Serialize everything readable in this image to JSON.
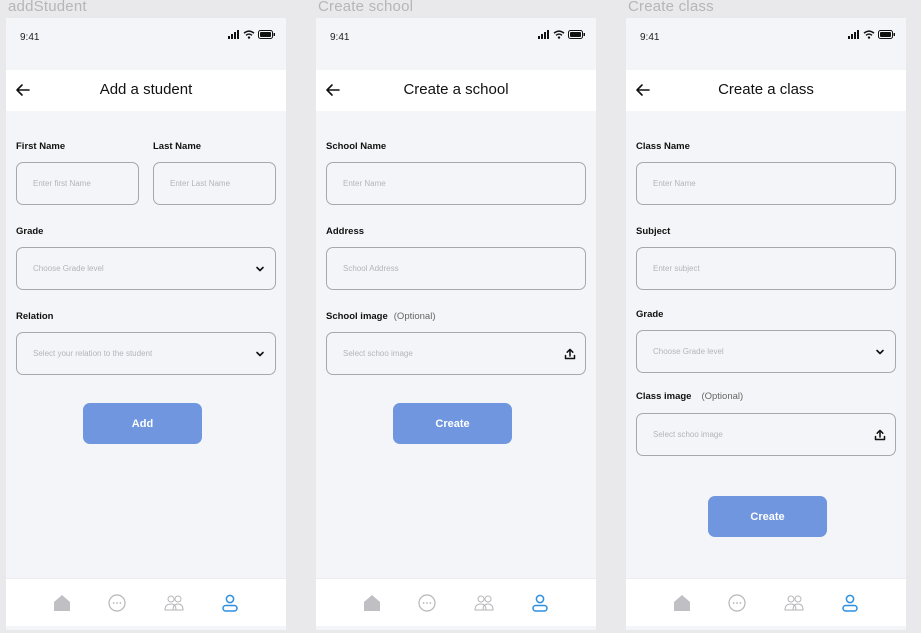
{
  "status": {
    "time": "9:41"
  },
  "colors": {
    "accent": "#6f96df",
    "active_tab": "#2d8fe0",
    "inactive_tab": "#b6b6bb"
  },
  "screens": [
    {
      "frame_title": "addStudent",
      "title": "Add a student",
      "first_name_label": "First Name",
      "first_name_placeholder": "Enter first Name",
      "last_name_label": "Last Name",
      "last_name_placeholder": "Enter Last Name",
      "grade_label": "Grade",
      "grade_placeholder": "Choose Grade level",
      "relation_label": "Relation",
      "relation_placeholder": "Select your relation to the student",
      "button": "Add"
    },
    {
      "frame_title": "Create school",
      "title": "Create a school",
      "name_label": "School Name",
      "name_placeholder": "Enter Name",
      "address_label": "Address",
      "address_placeholder": "School Address",
      "image_label": "School image",
      "image_optional": "(Optional)",
      "image_placeholder": "Select schoo image",
      "button": "Create"
    },
    {
      "frame_title": "Create class",
      "title": "Create a class",
      "name_label": "Class Name",
      "name_placeholder": "Enter Name",
      "subject_label": "Subject",
      "subject_placeholder": "Enter subject",
      "grade_label": "Grade",
      "grade_placeholder": "Choose Grade level",
      "image_label": "Class image",
      "image_optional": "(Optional)",
      "image_placeholder": "Select schoo image",
      "button": "Create"
    }
  ],
  "nav": {
    "icons": [
      "home-icon",
      "chat-icon",
      "people-icon",
      "profile-icon"
    ],
    "active": "profile-icon"
  }
}
